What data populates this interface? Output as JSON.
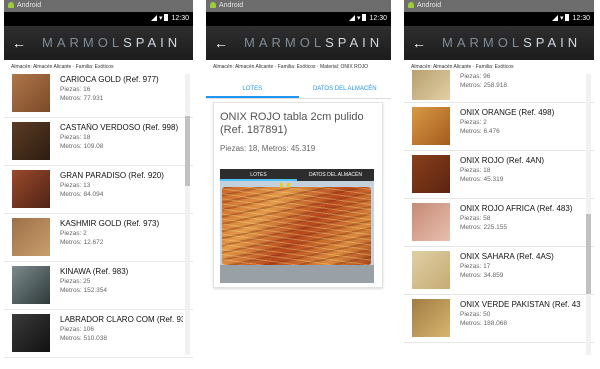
{
  "os_label": "Android",
  "clock": "12:30",
  "brand": {
    "part1": "MARMOL",
    "part2": "SPAIN"
  },
  "screen1": {
    "breadcrumb": "Almacén: Almacén Alicante · Familia: Exóticos",
    "items": [
      {
        "name": "CARIOCA GOLD (Ref. 977)",
        "piezas": "Piezas: 16",
        "metros": "Metros: 77.931",
        "c1": "#b0764a",
        "c2": "#7a4a28"
      },
      {
        "name": "CASTAÑO VERDOSO (Ref. 998)",
        "piezas": "Piezas: 18",
        "metros": "Metros: 109.08",
        "c1": "#5a3b24",
        "c2": "#2e1d12"
      },
      {
        "name": "GRAN PARADISO (Ref. 920)",
        "piezas": "Piezas: 13",
        "metros": "Metros: 84.094",
        "c1": "#9a4a2b",
        "c2": "#4f2216"
      },
      {
        "name": "KASHMIR GOLD (Ref. 973)",
        "piezas": "Piezas: 2",
        "metros": "Metros: 12.672",
        "c1": "#9d7046",
        "c2": "#c99e6e"
      },
      {
        "name": "KINAWA (Ref. 983)",
        "piezas": "Piezas: 25",
        "metros": "Metros: 152.354",
        "c1": "#7b8a8c",
        "c2": "#2f3a3a"
      },
      {
        "name": "LABRADOR CLARO COM (Ref. 93",
        "piezas": "Piezas: 106",
        "metros": "Metros: 510.038",
        "c1": "#3a3a3a",
        "c2": "#111111"
      }
    ]
  },
  "screen2": {
    "breadcrumb": "Almacén: Almacén Alicante · Familia: Exóticos · Material: ONIX ROJO",
    "tab1": "LOTES",
    "tab2": "DATOS DEL ALMACÉN",
    "card_title": "ONIX ROJO tabla 2cm pulido (Ref. 187891)",
    "card_stock": "Piezas: 18, Metros: 45.319",
    "photo_tab1": "LOTES",
    "photo_tab2": "DATOS DEL ALMACÉN"
  },
  "screen3": {
    "breadcrumb": "Almacén: Almacén Alicante · Familia: Exóticos",
    "partial": {
      "piezas": "Piezas: 96",
      "metros": "Metros: 258.918",
      "c1": "#b7a070",
      "c2": "#e2cfa4"
    },
    "items": [
      {
        "name": "ONIX ORANGE (Ref. 498)",
        "piezas": "Piezas: 2",
        "metros": "Metros: 6.476",
        "c1": "#d89a45",
        "c2": "#a55a1e"
      },
      {
        "name": "ONIX ROJO (Ref. 4AN)",
        "piezas": "Piezas: 18",
        "metros": "Metros: 45.319",
        "c1": "#8a3f1c",
        "c2": "#5a2410"
      },
      {
        "name": "ONIX ROJO AFRICA (Ref. 483)",
        "piezas": "Piezas: 58",
        "metros": "Metros: 225.155",
        "c1": "#c58a76",
        "c2": "#e8bfae"
      },
      {
        "name": "ONIX SAHARA (Ref. 4AS)",
        "piezas": "Piezas: 17",
        "metros": "Metros: 34.859",
        "c1": "#e0cfa6",
        "c2": "#c6ab74"
      },
      {
        "name": "ONIX VERDE PAKISTAN (Ref. 43",
        "piezas": "Piezas: 50",
        "metros": "Metros: 188.068",
        "c1": "#a07c44",
        "c2": "#d8b56e"
      }
    ]
  }
}
